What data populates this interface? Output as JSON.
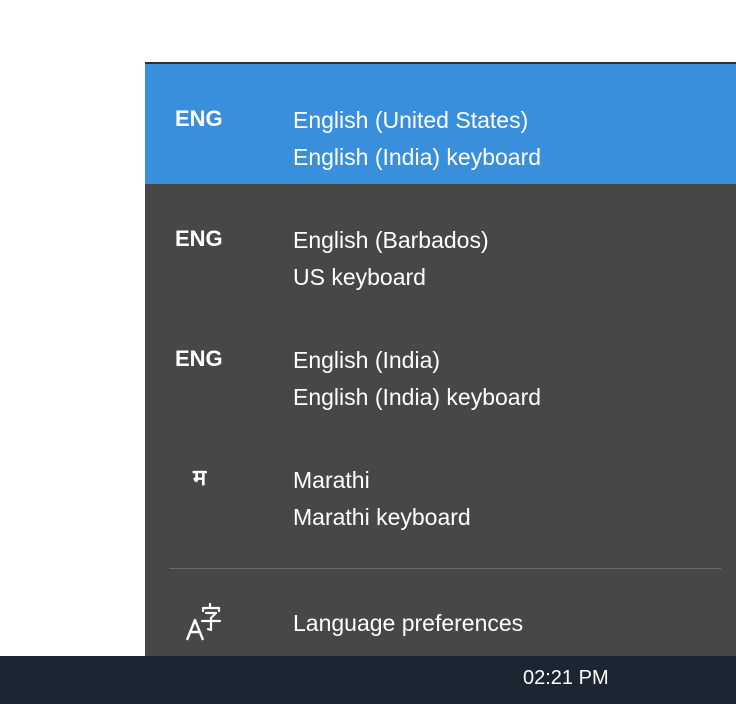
{
  "flyout": {
    "languages": [
      {
        "code": "ENG",
        "name": "English (United States)",
        "keyboard": "English (India) keyboard",
        "selected": true
      },
      {
        "code": "ENG",
        "name": "English (Barbados)",
        "keyboard": "US keyboard",
        "selected": false
      },
      {
        "code": "ENG",
        "name": "English (India)",
        "keyboard": "English (India) keyboard",
        "selected": false
      },
      {
        "code": "म",
        "name": "Marathi",
        "keyboard": "Marathi keyboard",
        "selected": false
      }
    ],
    "preferences": {
      "label": "Language preferences",
      "icon": "language-settings-icon"
    }
  },
  "taskbar": {
    "clock": "02:21 PM"
  },
  "colors": {
    "flyout_bg": "#474747",
    "selected_bg": "#3a8fdc",
    "taskbar_bg": "#1c2633",
    "text": "#ffffff"
  }
}
